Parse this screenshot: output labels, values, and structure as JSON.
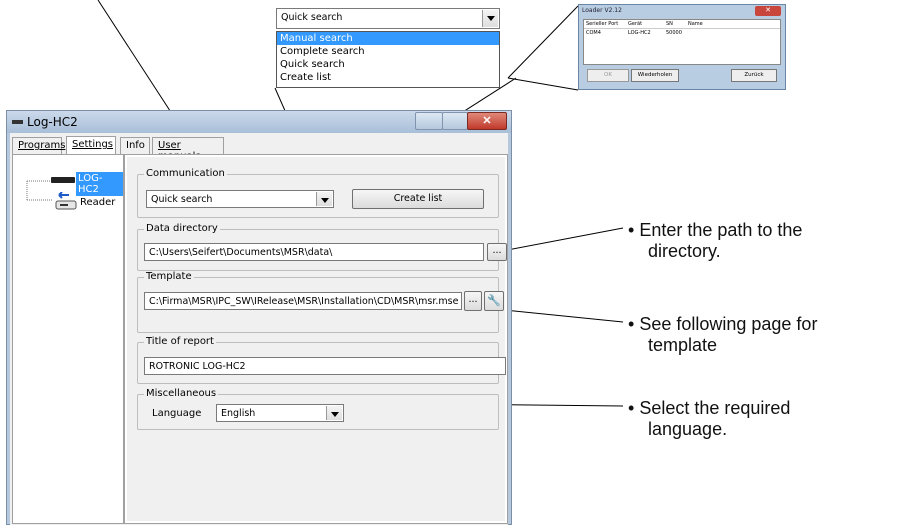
{
  "dropdown_popup": {
    "selected": "Quick search",
    "options": [
      "Manual search",
      "Complete search",
      "Quick search",
      "Create list"
    ]
  },
  "loader": {
    "title": "Loader V2.12",
    "columns": [
      "Serieller Port",
      "Gerät",
      "SN",
      "Name"
    ],
    "row": [
      "COM4",
      "LOG-HC2",
      "50000",
      ""
    ],
    "buttons": {
      "ok": "OK",
      "repeat": "Wiederholen",
      "back": "Zurück"
    }
  },
  "window": {
    "title": "Log-HC2",
    "tabs": [
      "Programs",
      "Settings",
      "Info",
      "User manuals"
    ],
    "tree": {
      "root": "LOG-HC2",
      "child": "Reader"
    }
  },
  "communication": {
    "label": "Communication",
    "value": "Quick search",
    "create_list": "Create list"
  },
  "data_directory": {
    "label": "Data directory",
    "value": "C:\\Users\\Seifert\\Documents\\MSR\\data\\",
    "browse": "..."
  },
  "template": {
    "label": "Template",
    "value": "C:\\Firma\\MSR\\IPC_SW\\IRelease\\MSR\\Installation\\CD\\MSR\\msr.mse",
    "browse": "..."
  },
  "report": {
    "label": "Title of report",
    "value": "ROTRONIC LOG-HC2"
  },
  "misc": {
    "label": "Miscellaneous",
    "language_label": "Language",
    "language_value": "English"
  },
  "callouts": {
    "directory": [
      "Enter the path to the",
      "directory."
    ],
    "template": [
      "See following page for",
      "template"
    ],
    "language": [
      "Select the required",
      "language."
    ]
  }
}
